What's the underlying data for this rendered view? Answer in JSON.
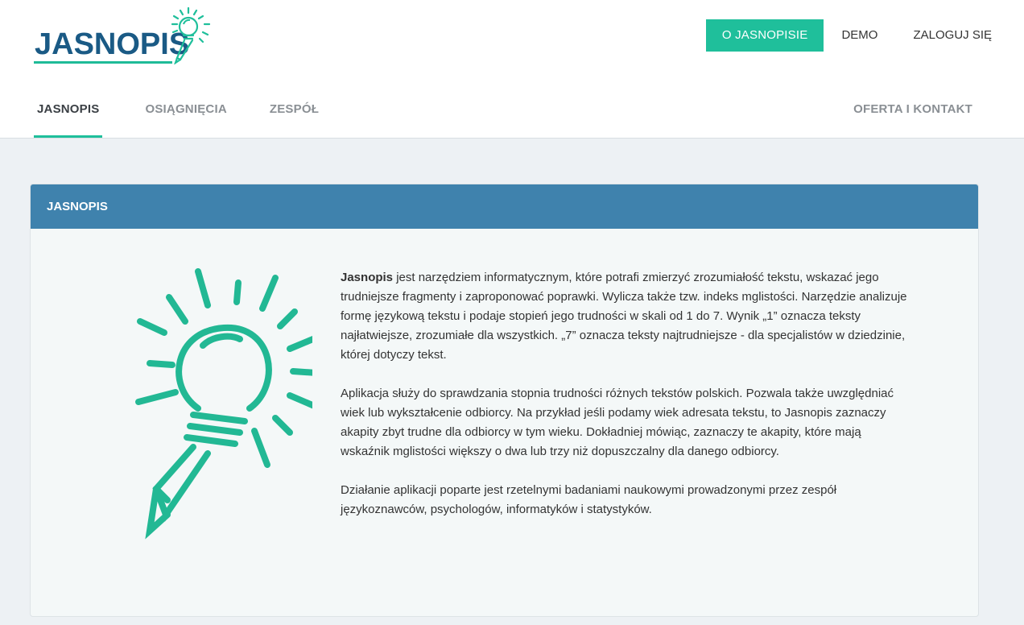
{
  "brand": {
    "name": "JASNOPIS",
    "accent": "#1fbf9b",
    "primary": "#1a5a85",
    "panel_header": "#3f82ad"
  },
  "top_nav": {
    "about": "O JASNOPISIE",
    "demo": "DEMO",
    "login": "ZALOGUJ SIĘ"
  },
  "tabs": [
    {
      "label": "JASNOPIS",
      "active": true
    },
    {
      "label": "OSIĄGNIĘCIA",
      "active": false
    },
    {
      "label": "ZESPÓŁ",
      "active": false
    }
  ],
  "tab_right": "OFERTA I KONTAKT",
  "panel": {
    "title": "JASNOPIS",
    "illustration_icon": "lightbulb-pencil-icon",
    "p1_bold": "Jasnopis",
    "p1_rest": " jest narzędziem informatycznym, które potrafi zmierzyć zrozumiałość tekstu, wskazać jego trudniejsze fragmenty i zaproponować poprawki. Wylicza także tzw. indeks mglistości. Narzędzie analizuje formę językową tekstu i podaje stopień jego trudności w skali od 1 do 7. Wynik „1” oznacza teksty najłatwiejsze, zrozumiałe dla wszystkich. „7” oznacza teksty najtrudniejsze - dla specjalistów w dziedzinie, której dotyczy tekst.",
    "p2": "Aplikacja służy do sprawdzania stopnia trudności różnych tekstów polskich. Pozwala także uwzględniać wiek lub wykształcenie odbiorcy. Na przykład jeśli podamy wiek adresata tekstu, to Jasnopis zaznaczy akapity zbyt trudne dla odbiorcy w tym wieku. Dokładniej mówiąc, zaznaczy te akapity, które mają wskaźnik mglistości większy o dwa lub trzy niż dopuszczalny dla danego odbiorcy.",
    "p3": "Działanie aplikacji poparte jest rzetelnymi badaniami naukowymi prowadzonymi przez zespół językoznawców, psychologów, informatyków i statystyków."
  }
}
